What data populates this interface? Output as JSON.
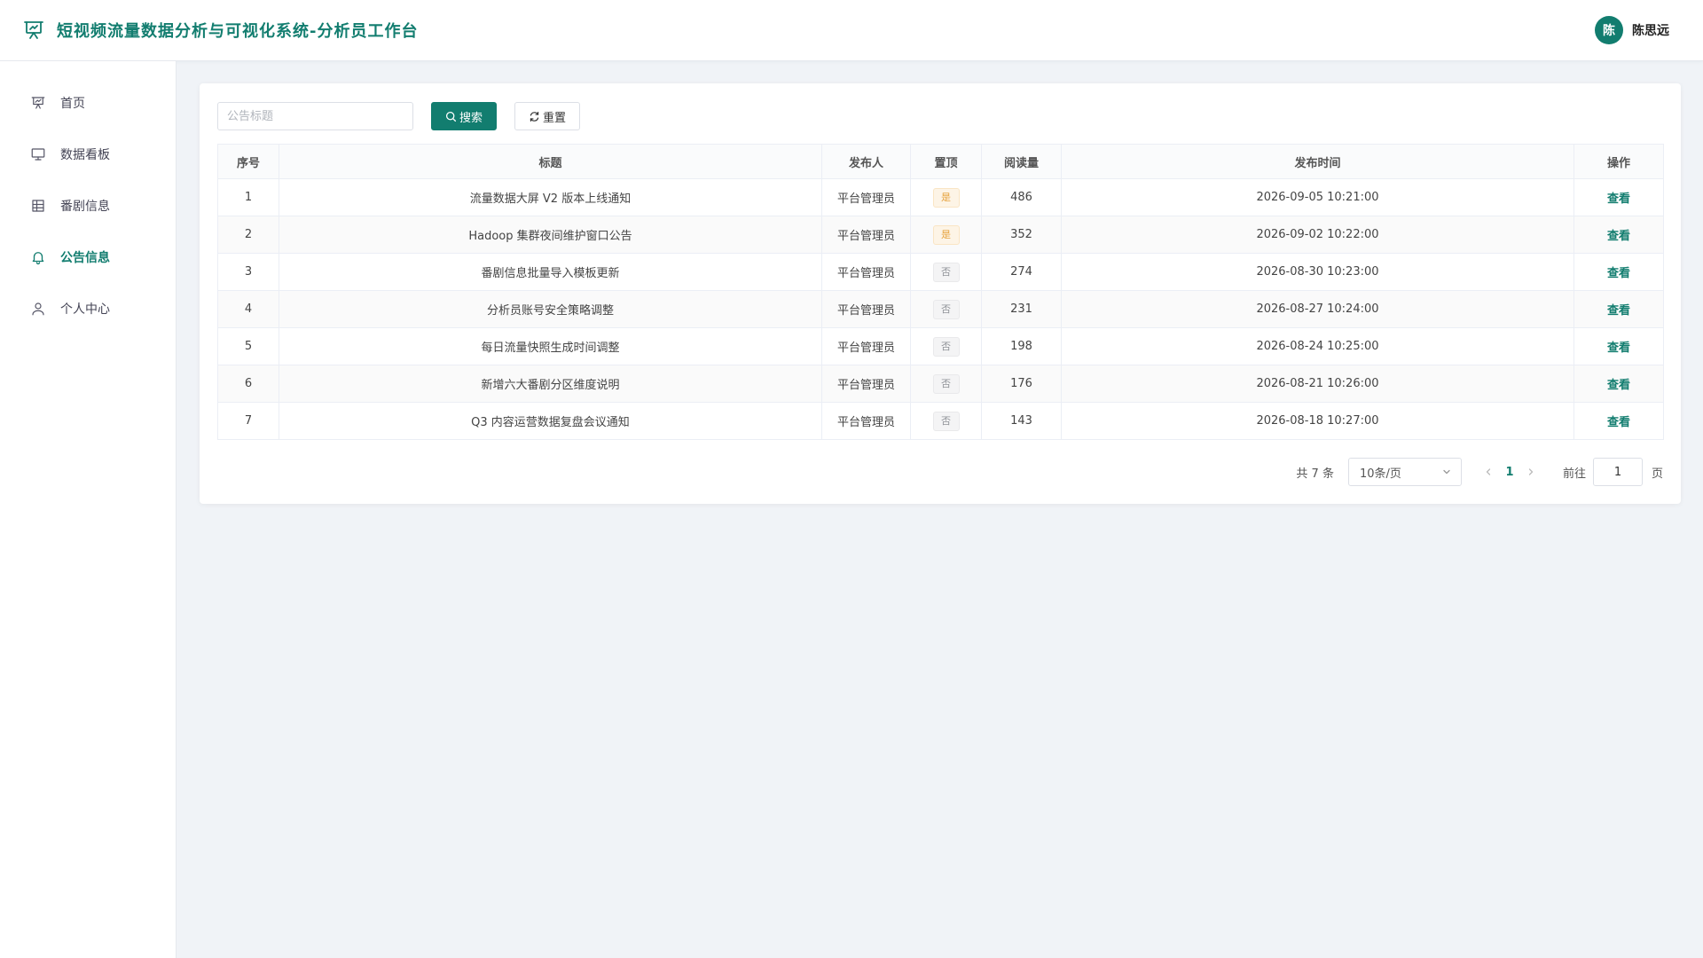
{
  "app": {
    "title": "短视频流量数据分析与可视化系统-分析员工作台",
    "brand_color": "#127d6f"
  },
  "user": {
    "avatar_text": "陈",
    "name": "陈思远"
  },
  "sidebar": {
    "items": [
      {
        "label": "首页",
        "icon": "presentation-icon",
        "active": false
      },
      {
        "label": "数据看板",
        "icon": "monitor-icon",
        "active": false
      },
      {
        "label": "番剧信息",
        "icon": "grid-icon",
        "active": false
      },
      {
        "label": "公告信息",
        "icon": "bell-icon",
        "active": true
      },
      {
        "label": "个人中心",
        "icon": "user-icon",
        "active": false
      }
    ]
  },
  "toolbar": {
    "search_placeholder": "公告标题",
    "search_value": "",
    "search_label": "搜索",
    "reset_label": "重置"
  },
  "table": {
    "headers": [
      "序号",
      "标题",
      "发布人",
      "置顶",
      "阅读量",
      "发布时间",
      "操作"
    ],
    "rows": [
      {
        "index": "1",
        "title": "流量数据大屏 V2 版本上线通知",
        "publisher": "平台管理员",
        "pinned": "是",
        "views": "486",
        "time": "2026-09-05 10:21:00",
        "action": "查看"
      },
      {
        "index": "2",
        "title": "Hadoop 集群夜间维护窗口公告",
        "publisher": "平台管理员",
        "pinned": "是",
        "views": "352",
        "time": "2026-09-02 10:22:00",
        "action": "查看"
      },
      {
        "index": "3",
        "title": "番剧信息批量导入模板更新",
        "publisher": "平台管理员",
        "pinned": "否",
        "views": "274",
        "time": "2026-08-30 10:23:00",
        "action": "查看"
      },
      {
        "index": "4",
        "title": "分析员账号安全策略调整",
        "publisher": "平台管理员",
        "pinned": "否",
        "views": "231",
        "time": "2026-08-27 10:24:00",
        "action": "查看"
      },
      {
        "index": "5",
        "title": "每日流量快照生成时间调整",
        "publisher": "平台管理员",
        "pinned": "否",
        "views": "198",
        "time": "2026-08-24 10:25:00",
        "action": "查看"
      },
      {
        "index": "6",
        "title": "新增六大番剧分区维度说明",
        "publisher": "平台管理员",
        "pinned": "否",
        "views": "176",
        "time": "2026-08-21 10:26:00",
        "action": "查看"
      },
      {
        "index": "7",
        "title": "Q3 内容运营数据复盘会议通知",
        "publisher": "平台管理员",
        "pinned": "否",
        "views": "143",
        "time": "2026-08-18 10:27:00",
        "action": "查看"
      }
    ]
  },
  "pagination": {
    "total_text": "共 7 条",
    "page_size": "10条/页",
    "current_page": "1",
    "goto_label": "前往",
    "goto_value": "1",
    "goto_suffix": "页"
  }
}
